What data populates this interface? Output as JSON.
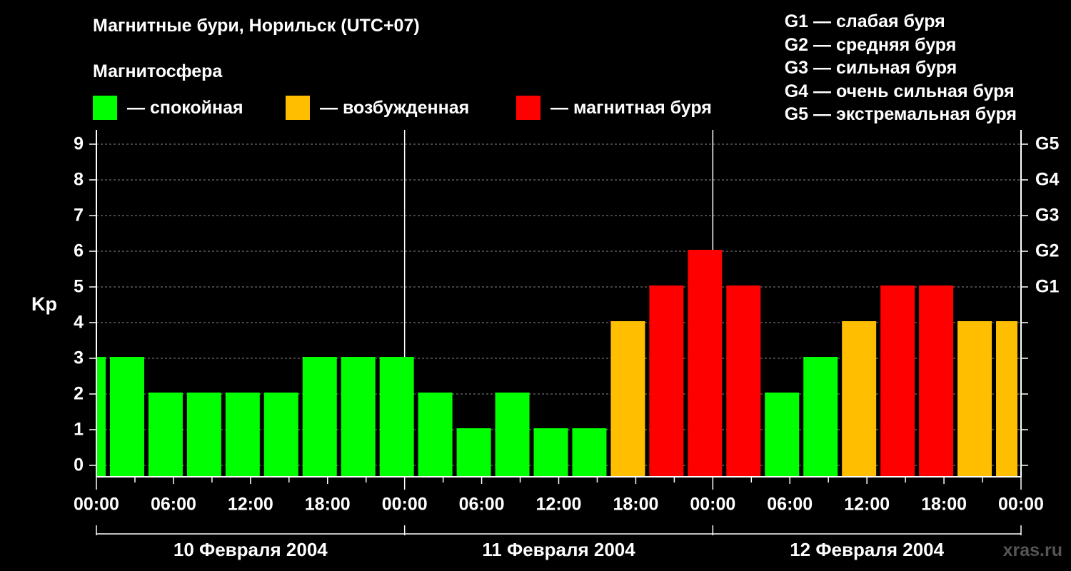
{
  "header": {
    "title": "Магнитные бури, Норильск (UTC+07)",
    "subtitle": "Магнитосфера"
  },
  "legend": [
    {
      "label": "— спокойная",
      "color": "#00ff00"
    },
    {
      "label": "— возбужденная",
      "color": "#ffbf00"
    },
    {
      "label": "— магнитная буря",
      "color": "#ff0000"
    }
  ],
  "g_levels": [
    "G1 — слабая буря",
    "G2 — средняя буря",
    "G3 — сильная буря",
    "G4 — очень сильная буря",
    "G5 — экстремальная буря"
  ],
  "watermark": "xras.ru",
  "chart_data": {
    "type": "bar",
    "ylabel": "Kp",
    "ylim": [
      0,
      9
    ],
    "y_ticks": [
      "0",
      "1",
      "2",
      "3",
      "4",
      "5",
      "6",
      "7",
      "8",
      "9"
    ],
    "right_axis": [
      {
        "value": 5,
        "label": "G1"
      },
      {
        "value": 6,
        "label": "G2"
      },
      {
        "value": 7,
        "label": "G3"
      },
      {
        "value": 8,
        "label": "G4"
      },
      {
        "value": 9,
        "label": "G5"
      }
    ],
    "x_ticks": [
      "00:00",
      "06:00",
      "12:00",
      "18:00",
      "00:00",
      "06:00",
      "12:00",
      "18:00",
      "00:00",
      "06:00",
      "12:00",
      "18:00",
      "00:00"
    ],
    "days": [
      "10 Февраля 2004",
      "11 Февраля 2004",
      "12 Февраля 2004"
    ],
    "bar_interval_hours": 3,
    "time_range_hours": [
      0,
      72
    ],
    "bars": [
      {
        "start_hour": 0,
        "end_hour": 1,
        "kp": 3
      },
      {
        "start_hour": 1,
        "end_hour": 4,
        "kp": 3
      },
      {
        "start_hour": 4,
        "end_hour": 7,
        "kp": 2
      },
      {
        "start_hour": 7,
        "end_hour": 10,
        "kp": 2
      },
      {
        "start_hour": 10,
        "end_hour": 13,
        "kp": 2
      },
      {
        "start_hour": 13,
        "end_hour": 16,
        "kp": 2
      },
      {
        "start_hour": 16,
        "end_hour": 19,
        "kp": 3
      },
      {
        "start_hour": 19,
        "end_hour": 22,
        "kp": 3
      },
      {
        "start_hour": 22,
        "end_hour": 25,
        "kp": 3
      },
      {
        "start_hour": 25,
        "end_hour": 28,
        "kp": 2
      },
      {
        "start_hour": 28,
        "end_hour": 31,
        "kp": 1
      },
      {
        "start_hour": 31,
        "end_hour": 34,
        "kp": 2
      },
      {
        "start_hour": 34,
        "end_hour": 37,
        "kp": 1
      },
      {
        "start_hour": 37,
        "end_hour": 40,
        "kp": 1
      },
      {
        "start_hour": 40,
        "end_hour": 43,
        "kp": 4
      },
      {
        "start_hour": 43,
        "end_hour": 46,
        "kp": 5
      },
      {
        "start_hour": 46,
        "end_hour": 49,
        "kp": 6
      },
      {
        "start_hour": 49,
        "end_hour": 52,
        "kp": 5
      },
      {
        "start_hour": 52,
        "end_hour": 55,
        "kp": 2
      },
      {
        "start_hour": 55,
        "end_hour": 58,
        "kp": 3
      },
      {
        "start_hour": 58,
        "end_hour": 61,
        "kp": 4
      },
      {
        "start_hour": 61,
        "end_hour": 64,
        "kp": 5
      },
      {
        "start_hour": 64,
        "end_hour": 67,
        "kp": 5
      },
      {
        "start_hour": 67,
        "end_hour": 70,
        "kp": 4
      },
      {
        "start_hour": 70,
        "end_hour": 72,
        "kp": 4
      }
    ],
    "color_thresholds": {
      "quiet_max": 3,
      "active_max": 4
    },
    "colors": {
      "quiet": "#00ff00",
      "active": "#ffbf00",
      "storm": "#ff0000",
      "grid": "#888888",
      "axis": "#ffffff"
    },
    "grid": true
  }
}
